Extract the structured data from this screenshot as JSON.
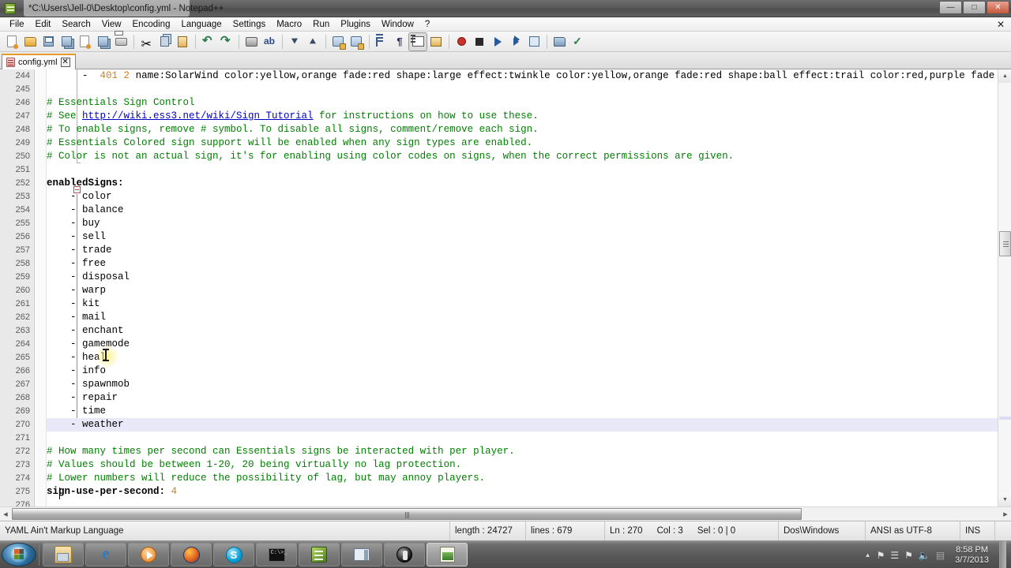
{
  "window": {
    "title": "*C:\\Users\\Jell-0\\Desktop\\config.yml - Notepad++",
    "minimize_label": "—",
    "maximize_label": "□",
    "close_label": "✕"
  },
  "menubar": {
    "items": [
      {
        "label": "File"
      },
      {
        "label": "Edit"
      },
      {
        "label": "Search"
      },
      {
        "label": "View"
      },
      {
        "label": "Encoding"
      },
      {
        "label": "Language"
      },
      {
        "label": "Settings"
      },
      {
        "label": "Macro"
      },
      {
        "label": "Run"
      },
      {
        "label": "Plugins"
      },
      {
        "label": "Window"
      },
      {
        "label": "?"
      }
    ],
    "doc_close_label": "✕"
  },
  "toolbar": {
    "buttons": [
      {
        "name": "new-file-icon",
        "glyph": "g-doc"
      },
      {
        "name": "open-file-icon",
        "glyph": "g-folder"
      },
      {
        "name": "save-icon",
        "glyph": "g-save"
      },
      {
        "name": "save-all-icon",
        "glyph": "g-saveall"
      },
      {
        "name": "close-file-icon",
        "glyph": "g-doc"
      },
      {
        "name": "close-all-files-icon",
        "glyph": "g-saveall"
      },
      {
        "name": "print-icon",
        "glyph": "g-print"
      },
      {
        "name": "separator-1",
        "glyph": "sep"
      },
      {
        "name": "cut-icon",
        "glyph": "g-cut"
      },
      {
        "name": "copy-icon",
        "glyph": "g-copy"
      },
      {
        "name": "paste-icon",
        "glyph": "g-paste"
      },
      {
        "name": "separator-2",
        "glyph": "sep"
      },
      {
        "name": "undo-icon",
        "glyph": "g-undo"
      },
      {
        "name": "redo-icon",
        "glyph": "g-redo"
      },
      {
        "name": "separator-3",
        "glyph": "sep"
      },
      {
        "name": "find-icon",
        "glyph": "g-find"
      },
      {
        "name": "replace-icon",
        "glyph": "g-replace"
      },
      {
        "name": "separator-4",
        "glyph": "sep"
      },
      {
        "name": "zoom-in-icon",
        "glyph": "g-zi"
      },
      {
        "name": "zoom-out-icon",
        "glyph": "g-zo"
      },
      {
        "name": "separator-5",
        "glyph": "sep"
      },
      {
        "name": "sync-vertical-scroll-icon",
        "glyph": "g-mark"
      },
      {
        "name": "sync-horizontal-scroll-icon",
        "glyph": "g-mark"
      },
      {
        "name": "separator-6",
        "glyph": "sep"
      },
      {
        "name": "word-wrap-icon",
        "glyph": "g-indent"
      },
      {
        "name": "show-all-characters-icon",
        "glyph": "g-para"
      },
      {
        "name": "show-indent-guide-icon",
        "glyph": "g-wrap"
      },
      {
        "name": "user-defined-dialog-icon",
        "glyph": "g-allchar"
      },
      {
        "name": "separator-7",
        "glyph": "sep"
      },
      {
        "name": "start-recording-icon",
        "glyph": "g-rec"
      },
      {
        "name": "stop-recording-icon",
        "glyph": "g-stop"
      },
      {
        "name": "play-macro-icon",
        "glyph": "g-play"
      },
      {
        "name": "run-macro-multiple-icon",
        "glyph": "g-playall"
      },
      {
        "name": "save-macro-icon",
        "glyph": "g-savemac"
      },
      {
        "name": "separator-8",
        "glyph": "sep"
      },
      {
        "name": "open-folder-icon",
        "glyph": "g-openfold"
      },
      {
        "name": "spell-check-icon",
        "glyph": "g-spell"
      }
    ],
    "active_index": 26
  },
  "tabs": [
    {
      "label": "config.yml",
      "close_label": "✕",
      "active": true
    }
  ],
  "editor": {
    "first_line": 244,
    "lines": [
      {
        "n": 244,
        "segs": [
          {
            "t": "      -  ",
            "c": "p"
          },
          {
            "t": "401",
            "c": "n"
          },
          {
            "t": " ",
            "c": "p"
          },
          {
            "t": "2",
            "c": "n"
          },
          {
            "t": " name:SolarWind color:yellow,orange fade:red shape:large effect:twinkle color:yellow,orange fade:red shape:ball effect:trail color:red,purple fade",
            "c": "p"
          }
        ]
      },
      {
        "n": 245,
        "segs": []
      },
      {
        "n": 246,
        "segs": [
          {
            "t": "# Essentials Sign Control",
            "c": "c"
          }
        ]
      },
      {
        "n": 247,
        "segs": [
          {
            "t": "# See ",
            "c": "c"
          },
          {
            "t": "http://wiki.ess3.net/wiki/Sign_Tutorial",
            "c": "l"
          },
          {
            "t": " for instructions on how to use these.",
            "c": "c"
          }
        ]
      },
      {
        "n": 248,
        "segs": [
          {
            "t": "# To enable signs, remove # symbol. To disable all signs, comment/remove each sign.",
            "c": "c"
          }
        ]
      },
      {
        "n": 249,
        "segs": [
          {
            "t": "# Essentials Colored sign support will be enabled when any sign types are enabled.",
            "c": "c"
          }
        ]
      },
      {
        "n": 250,
        "segs": [
          {
            "t": "# Color is not an actual sign, it's for enabling using color codes on signs, when the correct permissions are given.",
            "c": "c"
          }
        ]
      },
      {
        "n": 251,
        "segs": []
      },
      {
        "n": 252,
        "segs": [
          {
            "t": "enabledSigns:",
            "c": "k"
          }
        ]
      },
      {
        "n": 253,
        "segs": [
          {
            "t": "    - color",
            "c": "p"
          }
        ]
      },
      {
        "n": 254,
        "segs": [
          {
            "t": "    - balance",
            "c": "p"
          }
        ]
      },
      {
        "n": 255,
        "segs": [
          {
            "t": "    - buy",
            "c": "p"
          }
        ]
      },
      {
        "n": 256,
        "segs": [
          {
            "t": "    - sell",
            "c": "p"
          }
        ]
      },
      {
        "n": 257,
        "segs": [
          {
            "t": "    - trade",
            "c": "p"
          }
        ]
      },
      {
        "n": 258,
        "segs": [
          {
            "t": "    - free",
            "c": "p"
          }
        ]
      },
      {
        "n": 259,
        "segs": [
          {
            "t": "    - disposal",
            "c": "p"
          }
        ]
      },
      {
        "n": 260,
        "segs": [
          {
            "t": "    - warp",
            "c": "p"
          }
        ]
      },
      {
        "n": 261,
        "segs": [
          {
            "t": "    - kit",
            "c": "p"
          }
        ]
      },
      {
        "n": 262,
        "segs": [
          {
            "t": "    - mail",
            "c": "p"
          }
        ]
      },
      {
        "n": 263,
        "segs": [
          {
            "t": "    - enchant",
            "c": "p"
          }
        ]
      },
      {
        "n": 264,
        "segs": [
          {
            "t": "    - gamemode",
            "c": "p"
          }
        ]
      },
      {
        "n": 265,
        "segs": [
          {
            "t": "    - heal",
            "c": "p"
          }
        ]
      },
      {
        "n": 266,
        "segs": [
          {
            "t": "    - info",
            "c": "p"
          }
        ]
      },
      {
        "n": 267,
        "segs": [
          {
            "t": "    - spawnmob",
            "c": "p"
          }
        ]
      },
      {
        "n": 268,
        "segs": [
          {
            "t": "    - repair",
            "c": "p"
          }
        ]
      },
      {
        "n": 269,
        "segs": [
          {
            "t": "    - time",
            "c": "p"
          }
        ]
      },
      {
        "n": 270,
        "segs": [
          {
            "t": "    - weather",
            "c": "p"
          }
        ],
        "current": true
      },
      {
        "n": 271,
        "segs": []
      },
      {
        "n": 272,
        "segs": [
          {
            "t": "# How many times per second can Essentials signs be interacted with per player.",
            "c": "c"
          }
        ]
      },
      {
        "n": 273,
        "segs": [
          {
            "t": "# Values should be between 1-20, 20 being virtually no lag protection.",
            "c": "c"
          }
        ]
      },
      {
        "n": 274,
        "segs": [
          {
            "t": "# Lower numbers will reduce the possibility of lag, but may annoy players.",
            "c": "c"
          }
        ]
      },
      {
        "n": 275,
        "segs": [
          {
            "t": "sign-use-per-second: ",
            "c": "k"
          },
          {
            "t": "4",
            "c": "n"
          }
        ]
      },
      {
        "n": 276,
        "segs": []
      }
    ]
  },
  "scrollbars": {
    "v_up_label": "▲",
    "v_down_label": "▼",
    "h_left_label": "◀",
    "h_right_label": "▶"
  },
  "statusbar": {
    "language": "YAML Ain't Markup Language",
    "length_label": "length : 24727",
    "lines_label": "lines : 679",
    "ln": "Ln : 270",
    "col": "Col : 3",
    "sel": "Sel : 0 | 0",
    "eol": "Dos\\Windows",
    "encoding": "ANSI as UTF-8",
    "insert_mode": "INS"
  },
  "taskbar": {
    "start_tooltip": "Start",
    "items": [
      {
        "name": "taskbar-windows-explorer",
        "icon": "ico-explorer",
        "active": false
      },
      {
        "name": "taskbar-internet-explorer",
        "icon": "ico-ie",
        "label": "e",
        "active": false
      },
      {
        "name": "taskbar-windows-media-player",
        "icon": "ico-wmp",
        "active": false
      },
      {
        "name": "taskbar-firefox",
        "icon": "ico-ff",
        "active": false
      },
      {
        "name": "taskbar-skype",
        "icon": "ico-skype",
        "label": "S",
        "active": false
      },
      {
        "name": "taskbar-command-prompt",
        "icon": "ico-cmd",
        "label": "C:\\>_",
        "active": false
      },
      {
        "name": "taskbar-notepad-plus-plus-green",
        "icon": "ico-np",
        "active": false
      },
      {
        "name": "taskbar-window-app",
        "icon": "ico-win",
        "active": false
      },
      {
        "name": "taskbar-minecraft",
        "icon": "ico-mc",
        "active": false
      },
      {
        "name": "taskbar-notepad-plus-plus",
        "icon": "ico-npp2",
        "active": true
      }
    ],
    "tray": {
      "chevron": "▲",
      "icons": [
        "flag-icon",
        "network-icon",
        "action-center-icon",
        "volume-icon",
        "battery-icon"
      ],
      "time": "8:58 PM",
      "date": "3/7/2013"
    }
  },
  "colors": {
    "comment_green": "#008000",
    "url_blue": "#0000c0",
    "number_orange": "#d08020",
    "tab_accent": "#e89b2a",
    "current_line": "#e8e8f8"
  }
}
